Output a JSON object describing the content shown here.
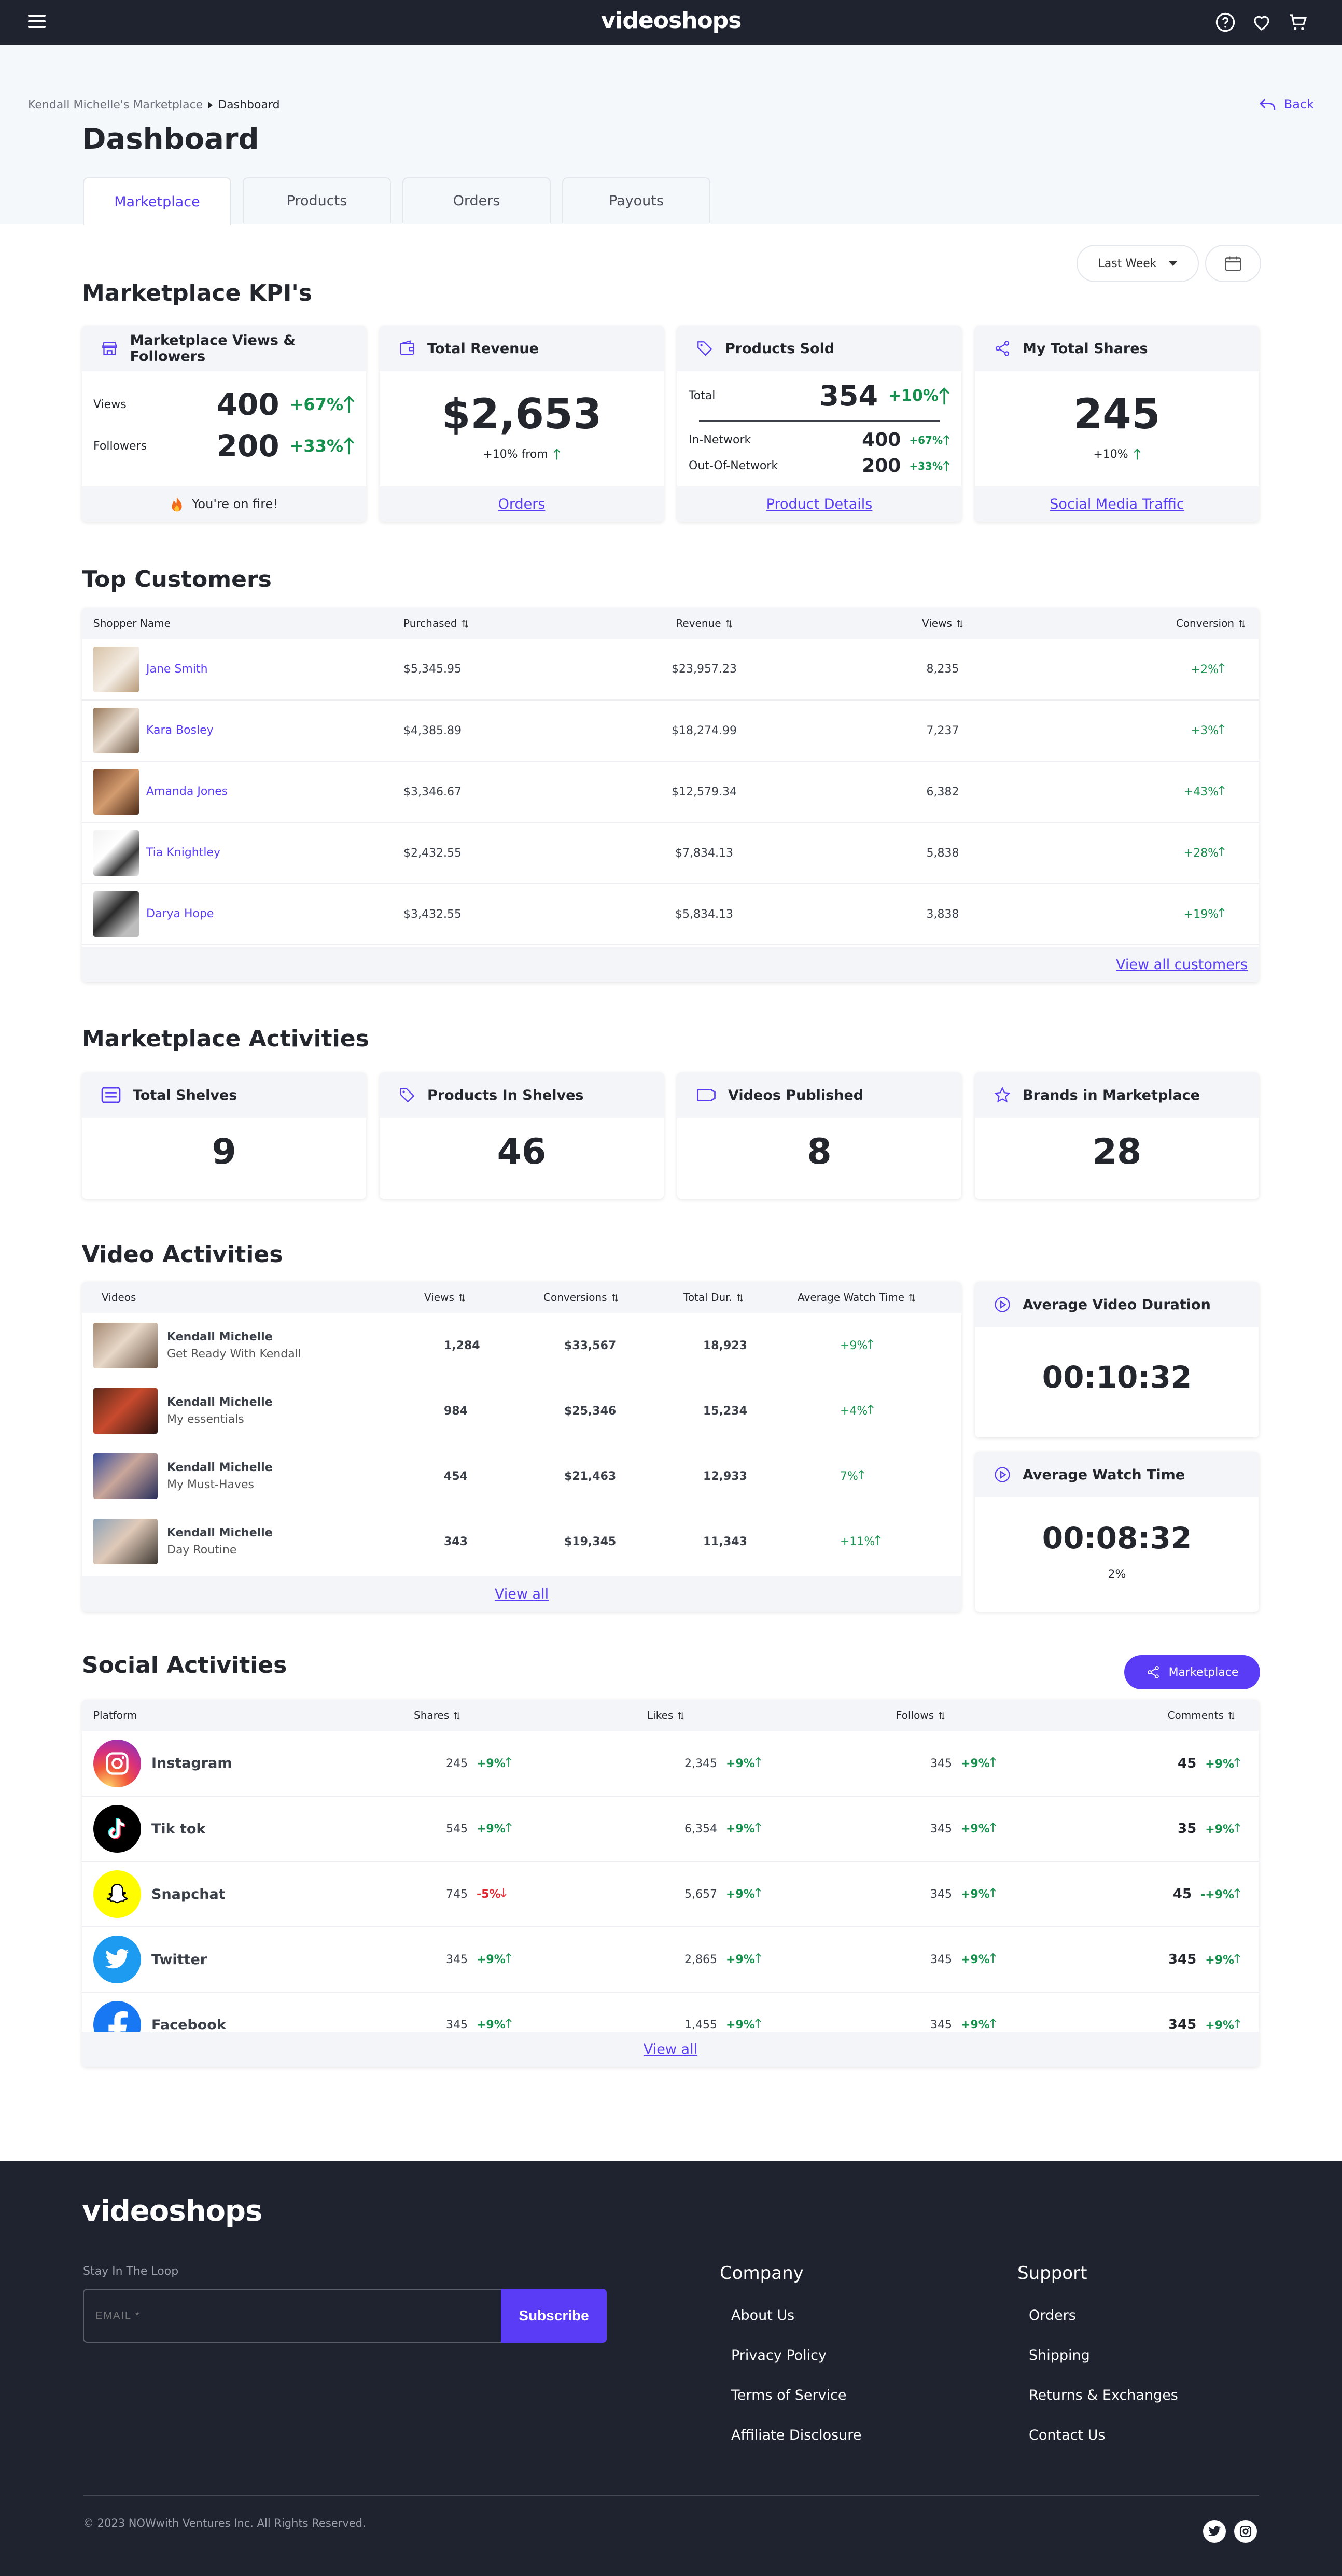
{
  "header": {
    "logo": "videoshops"
  },
  "breadcrumb": {
    "parent": "Kendall Michelle's Marketplace",
    "current": "Dashboard"
  },
  "back_label": "Back",
  "page_title": "Dashboard",
  "tabs": [
    {
      "label": "Marketplace",
      "active": true
    },
    {
      "label": "Products"
    },
    {
      "label": "Orders"
    },
    {
      "label": "Payouts"
    }
  ],
  "filter": {
    "period": "Last Week"
  },
  "kpi": {
    "title": "Marketplace KPI's",
    "views_card": {
      "title": "Marketplace Views & Followers",
      "views_label": "Views",
      "views": "400",
      "views_pct": "+67%",
      "followers_label": "Followers",
      "followers": "200",
      "followers_pct": "+33%",
      "footer": "You're on fire!"
    },
    "revenue_card": {
      "title": "Total Revenue",
      "value": "$2,653",
      "sub": "+10% from",
      "link": "Orders"
    },
    "products_card": {
      "title": "Products Sold",
      "total_label": "Total",
      "total": "354",
      "total_pct": "+10%",
      "in_label": "In-Network",
      "in": "400",
      "in_pct": "+67%",
      "out_label": "Out-Of-Network",
      "out": "200",
      "out_pct": "+33%",
      "link": "Product Details"
    },
    "shares_card": {
      "title": "My Total Shares",
      "value": "245",
      "sub": "+10%",
      "link": "Social Media Traffic"
    }
  },
  "customers": {
    "title": "Top Customers",
    "columns": [
      "Shopper Name",
      "Purchased",
      "Revenue",
      "Views",
      "Conversion"
    ],
    "rows": [
      {
        "name": "Jane Smith",
        "purchased": "$5,345.95",
        "revenue": "$23,957.23",
        "views": "8,235",
        "conversion": "+2%"
      },
      {
        "name": "Kara Bosley",
        "purchased": "$4,385.89",
        "revenue": "$18,274.99",
        "views": "7,237",
        "conversion": "+3%"
      },
      {
        "name": "Amanda Jones",
        "purchased": "$3,346.67",
        "revenue": "$12,579.34",
        "views": "6,382",
        "conversion": "+43%"
      },
      {
        "name": "Tia Knightley",
        "purchased": "$2,432.55",
        "revenue": "$7,834.13",
        "views": "5,838",
        "conversion": "+28%"
      },
      {
        "name": "Darya Hope",
        "purchased": "$3,432.55",
        "revenue": "$5,834.13",
        "views": "3,838",
        "conversion": "+19%"
      }
    ],
    "view_all": "View all customers"
  },
  "activities": {
    "title": "Marketplace Activities",
    "cards": [
      {
        "title": "Total Shelves",
        "value": "9"
      },
      {
        "title": "Products In Shelves",
        "value": "46"
      },
      {
        "title": "Videos Published",
        "value": "8"
      },
      {
        "title": "Brands in Marketplace",
        "value": "28"
      }
    ]
  },
  "video": {
    "title": "Video Activities",
    "columns": [
      "Videos",
      "Views",
      "Conversions",
      "Total  Dur.",
      "Average Watch Time"
    ],
    "rows": [
      {
        "creator": "Kendall Michelle",
        "title": "Get Ready With Kendall",
        "views": "1,284",
        "conversions": "$33,567",
        "duration": "18,923",
        "watch": "+9%"
      },
      {
        "creator": "Kendall Michelle",
        "title": "My essentials",
        "views": "984",
        "conversions": "$25,346",
        "duration": "15,234",
        "watch": "+4%"
      },
      {
        "creator": "Kendall Michelle",
        "title": "My Must-Haves",
        "views": "454",
        "conversions": "$21,463",
        "duration": "12,933",
        "watch": "7%"
      },
      {
        "creator": "Kendall Michelle",
        "title": "Day Routine",
        "views": "343",
        "conversions": "$19,345",
        "duration": "11,343",
        "watch": "+11%"
      }
    ],
    "view_all": "View all",
    "avg_duration": {
      "title": "Average Video Duration",
      "value": "00:10:32"
    },
    "avg_watch": {
      "title": "Average Watch Time",
      "value": "00:08:32",
      "sub": "2%"
    }
  },
  "social": {
    "title": "Social Activities",
    "button": "Marketplace",
    "columns": [
      "Platform",
      "Shares",
      "Likes",
      "Follows",
      "Comments"
    ],
    "rows": [
      {
        "platform": "Instagram",
        "shares": "245",
        "shares_pct": "+9%",
        "likes": "2,345",
        "likes_pct": "+9%",
        "follows": "345",
        "follows_pct": "+9%",
        "comments": "45",
        "comments_pct": "+9%"
      },
      {
        "platform": "Tik tok",
        "shares": "545",
        "shares_pct": "+9%",
        "likes": "6,354",
        "likes_pct": "+9%",
        "follows": "345",
        "follows_pct": "+9%",
        "comments": "35",
        "comments_pct": "+9%"
      },
      {
        "platform": "Snapchat",
        "shares": "745",
        "shares_pct": "-5%",
        "likes": "5,657",
        "likes_pct": "+9%",
        "follows": "345",
        "follows_pct": "+9%",
        "comments": "45",
        "comments_pct": "-+9%"
      },
      {
        "platform": "Twitter",
        "shares": "345",
        "shares_pct": "+9%",
        "likes": "2,865",
        "likes_pct": "+9%",
        "follows": "345",
        "follows_pct": "+9%",
        "comments": "345",
        "comments_pct": "+9%"
      },
      {
        "platform": "Facebook",
        "shares": "345",
        "shares_pct": "+9%",
        "likes": "1,455",
        "likes_pct": "+9%",
        "follows": "345",
        "follows_pct": "+9%",
        "comments": "345",
        "comments_pct": "+9%"
      }
    ],
    "view_all": "View all"
  },
  "footer": {
    "logo": "videoshops",
    "newsletter_label": "Stay In The Loop",
    "email_placeholder": "EMAIL *",
    "subscribe": "Subscribe",
    "company": {
      "title": "Company",
      "links": [
        "About Us",
        "Privacy Policy",
        "Terms of Service",
        "Affiliate Disclosure"
      ]
    },
    "support": {
      "title": "Support",
      "links": [
        "Orders",
        "Shipping",
        "Returns & Exchanges",
        "Contact Us"
      ]
    },
    "copyright": "© 2023 NOWwith Ventures Inc. All Rights Reserved."
  },
  "colors": {
    "accent": "#5b3cf6",
    "dark": "#1f2330",
    "positive": "#16914d",
    "negative": "#e0262f"
  }
}
